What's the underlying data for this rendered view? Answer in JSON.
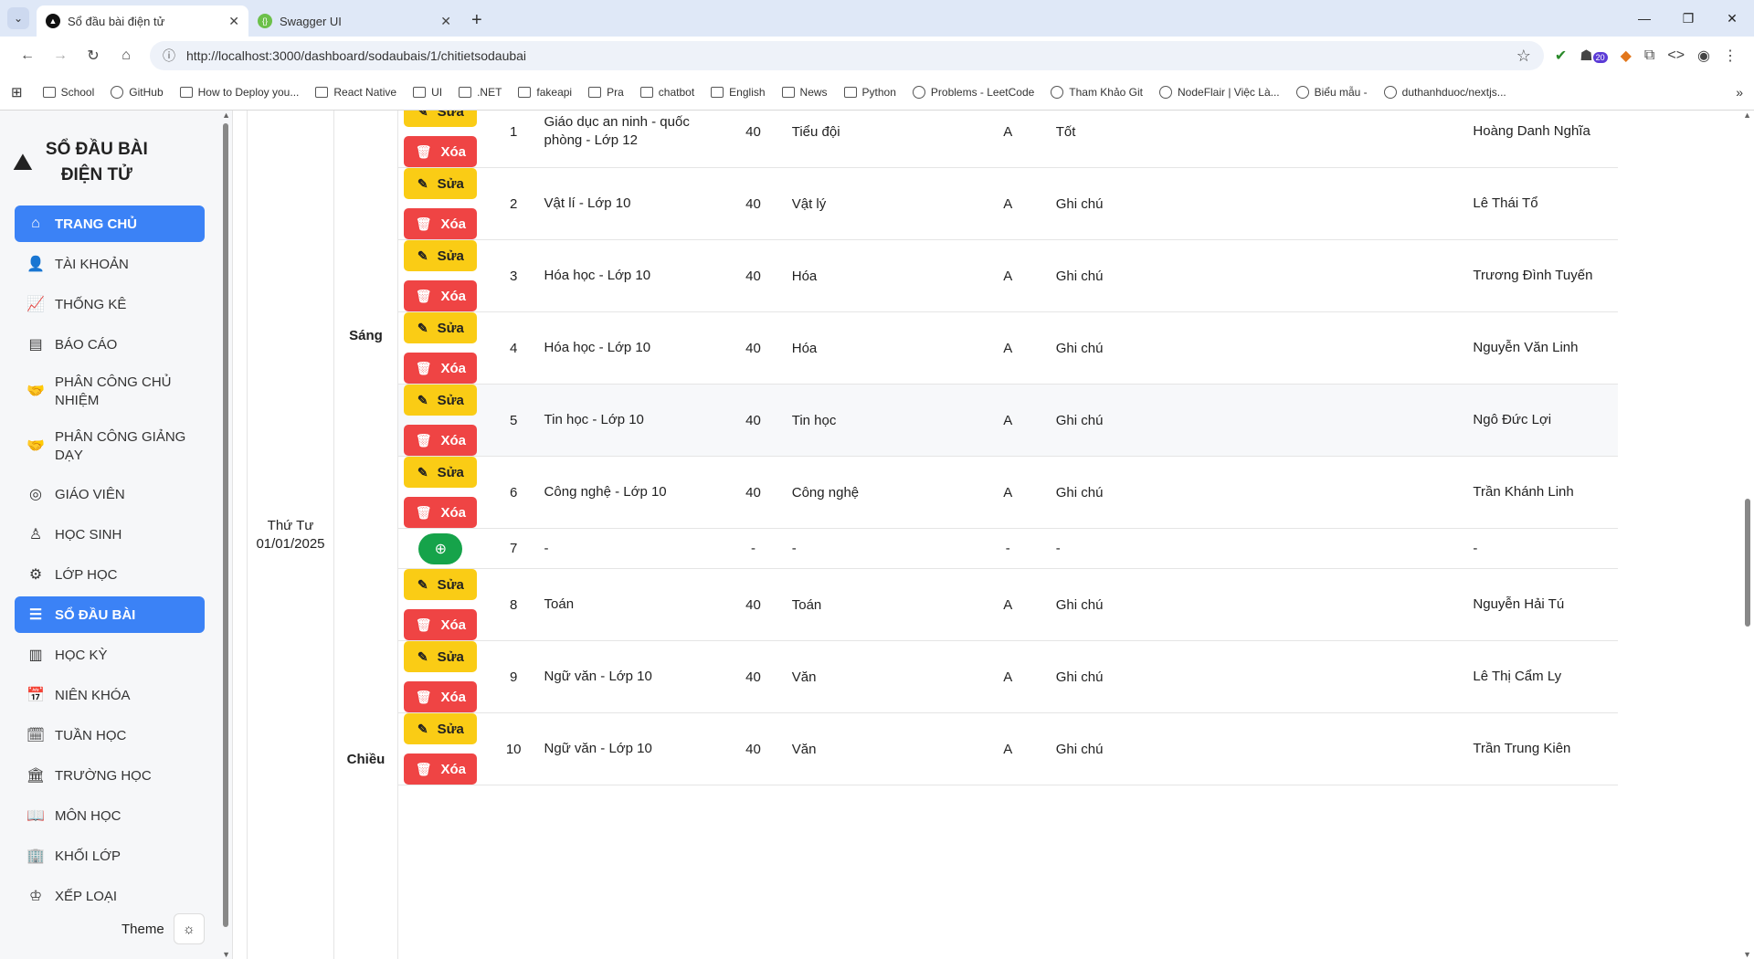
{
  "browser": {
    "tabs": [
      {
        "title": "Sổ đầu bài điện tử",
        "active": true
      },
      {
        "title": "Swagger UI",
        "active": false
      }
    ],
    "url": "http://localhost:3000/dashboard/sodaubais/1/chitietsodaubai",
    "extension_badge": "20",
    "bookmarks": [
      "School",
      "GitHub",
      "How to Deploy you...",
      "React Native",
      "UI",
      ".NET",
      "fakeapi",
      "Pra",
      "chatbot",
      "English",
      "News",
      "Python",
      "Problems - LeetCode",
      "Tham Khảo Git",
      "NodeFlair | Việc Là...",
      "Biểu mẫu -",
      "duthanhduoc/nextjs..."
    ]
  },
  "sidebar": {
    "brand": "SỔ ĐẦU BÀI ĐIỆN TỬ",
    "items": [
      {
        "label": "Trang chủ",
        "icon": "home-icon",
        "active": true
      },
      {
        "label": "Tài khoản",
        "icon": "user-icon",
        "active": false
      },
      {
        "label": "Thống kê",
        "icon": "chart-icon",
        "active": false
      },
      {
        "label": "Báo cáo",
        "icon": "report-icon",
        "active": false
      },
      {
        "label": "Phân công chủ nhiệm",
        "icon": "handshake-icon",
        "active": false
      },
      {
        "label": "Phân công giảng dạy",
        "icon": "handshake-icon",
        "active": false
      },
      {
        "label": "Giáo viên",
        "icon": "teacher-icon",
        "active": false
      },
      {
        "label": "Học sinh",
        "icon": "student-icon",
        "active": false
      },
      {
        "label": "Lớp học",
        "icon": "class-icon",
        "active": false
      },
      {
        "label": "Sổ đầu bài",
        "icon": "notebook-icon",
        "active": true
      },
      {
        "label": "Học kỳ",
        "icon": "semester-icon",
        "active": false
      },
      {
        "label": "Niên khóa",
        "icon": "calendar-icon",
        "active": false
      },
      {
        "label": "Tuần học",
        "icon": "calendar-week-icon",
        "active": false
      },
      {
        "label": "Trường học",
        "icon": "school-icon",
        "active": false
      },
      {
        "label": "Môn học",
        "icon": "book-icon",
        "active": false
      },
      {
        "label": "Khối lớp",
        "icon": "building-icon",
        "active": false
      },
      {
        "label": "Xếp loại",
        "icon": "rank-icon",
        "active": false
      }
    ],
    "theme_label": "Theme"
  },
  "table": {
    "day": "Thứ Tư",
    "date": "01/01/2025",
    "sessions": [
      "Sáng",
      "Chiều"
    ],
    "edit_label": "Sửa",
    "delete_label": "Xóa",
    "rows": [
      {
        "num": "1",
        "subject": "Giáo dục an ninh - quốc phòng - Lớp 12",
        "periods": "40",
        "content": "Tiểu đội",
        "grade": "A",
        "note": "Tốt",
        "teacher": "Hoàng Danh Nghĩa",
        "empty": false
      },
      {
        "num": "2",
        "subject": "Vật lí - Lớp 10",
        "periods": "40",
        "content": "Vật lý",
        "grade": "A",
        "note": "Ghi chú",
        "teacher": "Lê Thái Tổ",
        "empty": false
      },
      {
        "num": "3",
        "subject": "Hóa học - Lớp 10",
        "periods": "40",
        "content": "Hóa",
        "grade": "A",
        "note": "Ghi chú",
        "teacher": "Trương Đình Tuyến",
        "empty": false
      },
      {
        "num": "4",
        "subject": "Hóa học - Lớp 10",
        "periods": "40",
        "content": "Hóa",
        "grade": "A",
        "note": "Ghi chú",
        "teacher": "Nguyễn Văn Linh",
        "empty": false
      },
      {
        "num": "5",
        "subject": "Tin học - Lớp 10",
        "periods": "40",
        "content": "Tin học",
        "grade": "A",
        "note": "Ghi chú",
        "teacher": "Ngô Đức Lợi",
        "empty": false
      },
      {
        "num": "6",
        "subject": "Công nghệ - Lớp 10",
        "periods": "40",
        "content": "Công nghệ",
        "grade": "A",
        "note": "Ghi chú",
        "teacher": "Trần Khánh Linh",
        "empty": false
      },
      {
        "num": "7",
        "subject": "-",
        "periods": "-",
        "content": "-",
        "grade": "-",
        "note": "-",
        "teacher": "-",
        "empty": true
      },
      {
        "num": "8",
        "subject": "Toán",
        "periods": "40",
        "content": "Toán",
        "grade": "A",
        "note": "Ghi chú",
        "teacher": "Nguyễn Hải Tú",
        "empty": false
      },
      {
        "num": "9",
        "subject": "Ngữ văn - Lớp 10",
        "periods": "40",
        "content": "Văn",
        "grade": "A",
        "note": "Ghi chú",
        "teacher": "Lê Thị Cẩm Ly",
        "empty": false
      },
      {
        "num": "10",
        "subject": "Ngữ văn - Lớp 10",
        "periods": "40",
        "content": "Văn",
        "grade": "A",
        "note": "Ghi chú",
        "teacher": "Trần Trung Kiên",
        "empty": false
      }
    ]
  },
  "colors": {
    "primary": "#3b82f6",
    "edit": "#facc15",
    "delete": "#ef4444",
    "add": "#16a34a"
  }
}
